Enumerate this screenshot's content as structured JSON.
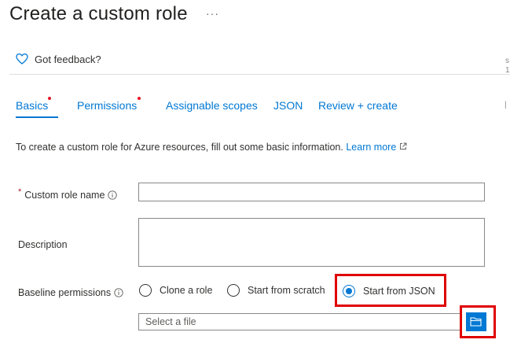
{
  "header": {
    "title": "Create a custom role",
    "more_label": "···"
  },
  "feedback": {
    "label": "Got feedback?"
  },
  "tabs": [
    {
      "label": "Basics",
      "required": true,
      "active": true
    },
    {
      "label": "Permissions",
      "required": true,
      "active": false
    },
    {
      "label": "Assignable scopes",
      "required": false,
      "active": false
    },
    {
      "label": "JSON",
      "required": false,
      "active": false
    },
    {
      "label": "Review + create",
      "required": false,
      "active": false
    }
  ],
  "intro": {
    "text": "To create a custom role for Azure resources, fill out some basic information.",
    "link_label": "Learn more"
  },
  "form": {
    "role_name": {
      "label": "Custom role name",
      "required_mark": "*",
      "value": ""
    },
    "description": {
      "label": "Description",
      "value": ""
    },
    "baseline": {
      "label": "Baseline permissions",
      "options": [
        {
          "label": "Clone a role",
          "checked": false
        },
        {
          "label": "Start from scratch",
          "checked": false
        },
        {
          "label": "Start from JSON",
          "checked": true
        }
      ]
    },
    "file": {
      "placeholder": "Select a file",
      "value": ""
    }
  },
  "colors": {
    "accent": "#0078d4",
    "required_dot": "#e81123",
    "highlight": "#e00000"
  },
  "icons": [
    "heart-icon",
    "info-icon",
    "external-link-icon",
    "folder-open-icon"
  ]
}
